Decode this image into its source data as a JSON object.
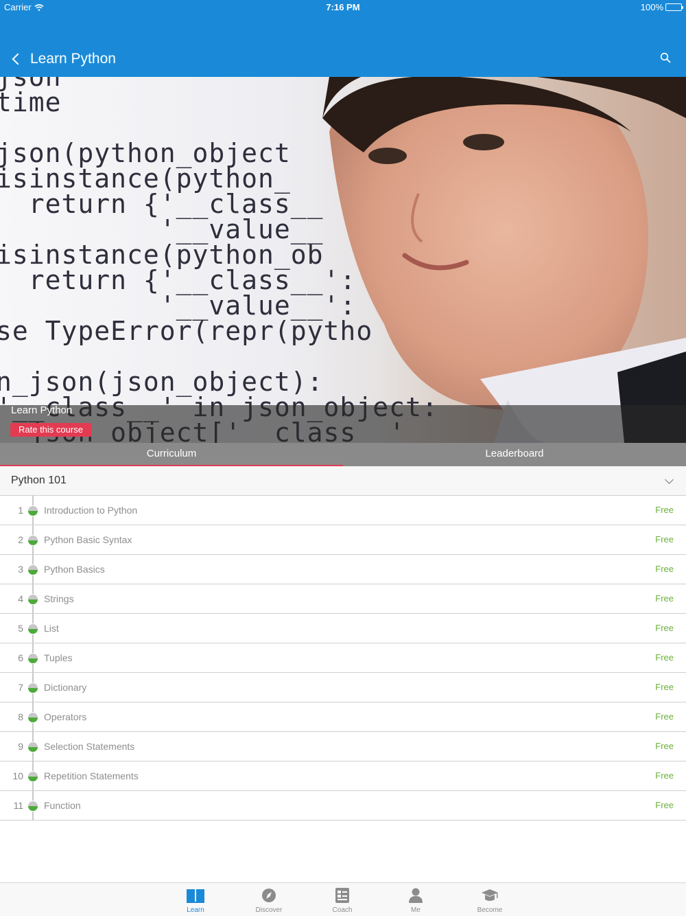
{
  "status_bar": {
    "carrier": "Carrier",
    "time": "7:16 PM",
    "battery": "100%"
  },
  "nav": {
    "title": "Learn Python",
    "back_icon": "chevron-left-icon",
    "search_icon": "search-icon"
  },
  "hero": {
    "code_lines": [
      "json",
      "time",
      "",
      "json(python_object",
      "isinstance(python_",
      "  return {'__class__",
      "          '__value__",
      "isinstance(python_ob",
      "  return {'__class__':",
      "          '__value__':",
      "se TypeError(repr(pytho",
      "",
      "n_json(json_object):",
      "'__class__' in json_object:",
      "  json_object['__class__'"
    ],
    "course_title": "Learn Python",
    "rate_label": "Rate this course"
  },
  "tabs": [
    {
      "label": "Curriculum",
      "active": true
    },
    {
      "label": "Leaderboard",
      "active": false
    }
  ],
  "section": {
    "title": "Python 101",
    "expand_icon": "chevron-down-icon"
  },
  "lessons": [
    {
      "num": "1",
      "name": "Introduction to Python",
      "price": "Free"
    },
    {
      "num": "2",
      "name": "Python Basic Syntax",
      "price": "Free"
    },
    {
      "num": "3",
      "name": "Python Basics",
      "price": "Free"
    },
    {
      "num": "4",
      "name": "Strings",
      "price": "Free"
    },
    {
      "num": "5",
      "name": "List",
      "price": "Free"
    },
    {
      "num": "6",
      "name": "Tuples",
      "price": "Free"
    },
    {
      "num": "7",
      "name": "Dictionary",
      "price": "Free"
    },
    {
      "num": "8",
      "name": "Operators",
      "price": "Free"
    },
    {
      "num": "9",
      "name": "Selection Statements",
      "price": "Free"
    },
    {
      "num": "10",
      "name": "Repetition Statements",
      "price": "Free"
    },
    {
      "num": "11",
      "name": "Function",
      "price": "Free"
    }
  ],
  "tab_bar": [
    {
      "label": "Learn",
      "icon": "book-icon",
      "active": true
    },
    {
      "label": "Discover",
      "icon": "compass-icon",
      "active": false
    },
    {
      "label": "Coach",
      "icon": "checklist-icon",
      "active": false
    },
    {
      "label": "Me",
      "icon": "person-icon",
      "active": false
    },
    {
      "label": "Become",
      "icon": "graduation-cap-icon",
      "active": false
    }
  ],
  "colors": {
    "primary": "#1a8ad8",
    "accent": "#e23b52",
    "free_green": "#6bb13a",
    "tab_gray": "#8a8a8a"
  }
}
